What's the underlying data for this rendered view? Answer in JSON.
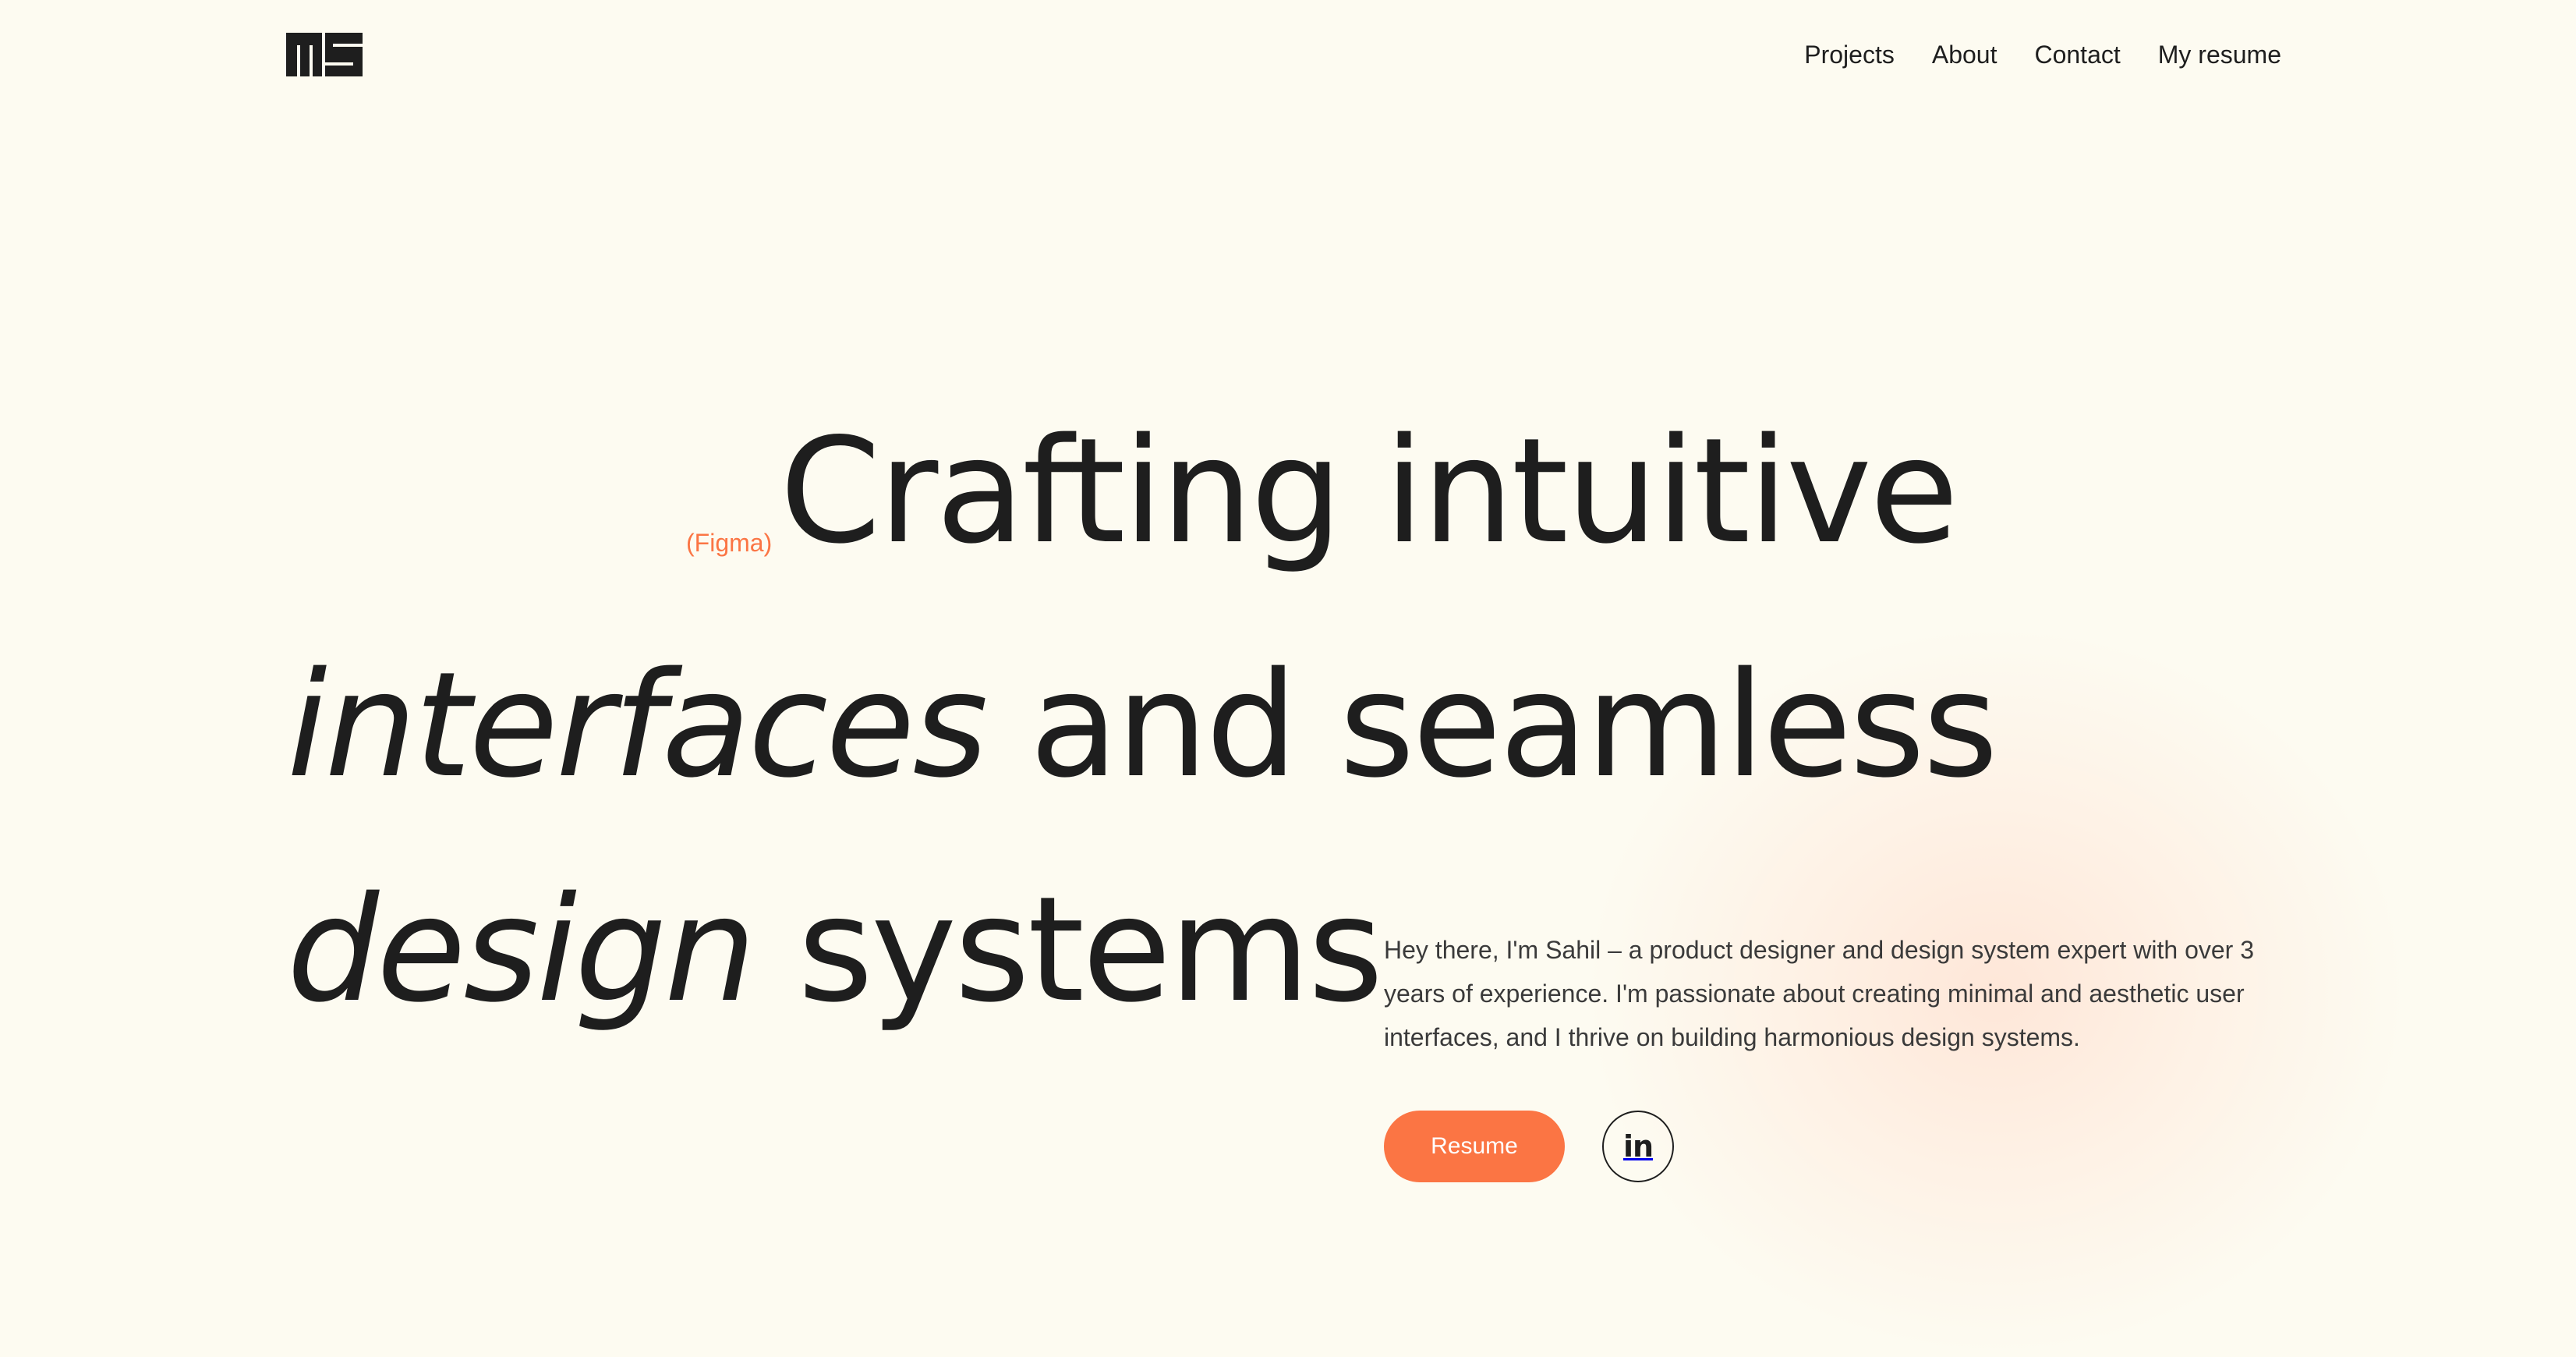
{
  "header": {
    "logo_text": "MS",
    "logo_icon": "ms-monogram-logo",
    "nav": [
      {
        "label": "Projects"
      },
      {
        "label": "About"
      },
      {
        "label": "Contact"
      },
      {
        "label": "My resume"
      }
    ]
  },
  "hero": {
    "tag": "(Figma)",
    "line1": "Crafting intuitive",
    "line2_italic": "interfaces",
    "line2_rest": " and seamless",
    "line3_italic": "design",
    "line3_rest": " systems",
    "intro": "Hey there, I'm Sahil – a product designer and design system expert with over 3 years of experience. I'm passionate about creating minimal and aesthetic user interfaces, and I thrive on building harmonious design systems.",
    "resume_button": "Resume",
    "linkedin_icon": "linkedin-icon",
    "linkedin_glyph": "in"
  },
  "colors": {
    "background": "#fdfbf1",
    "text": "#1e1e1e",
    "accent": "#fb7544",
    "glow": "#ffd6c4"
  }
}
